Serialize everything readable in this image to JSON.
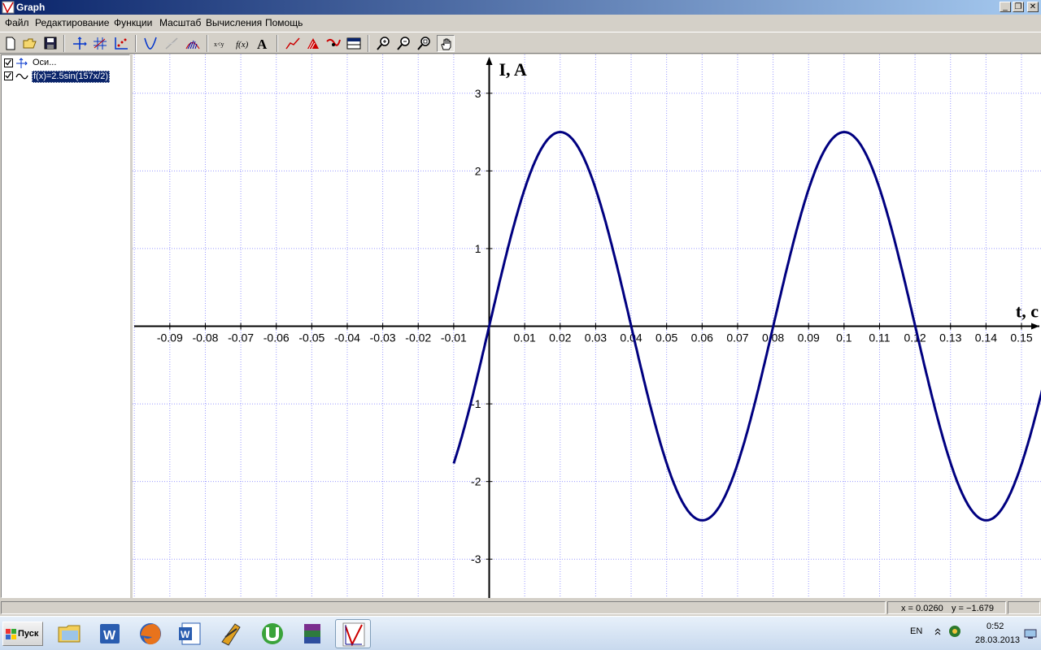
{
  "window": {
    "title": "Graph"
  },
  "menu": [
    "Файл",
    "Редактирование",
    "Функции",
    "Масштаб",
    "Вычисления",
    "Помощь"
  ],
  "toolbar": {
    "buttons": [
      "new-file",
      "open-folder",
      "save",
      "insert-axes",
      "insert-axes-grid",
      "insert-point-series",
      "insert-function",
      "insert-tangent",
      "insert-shading",
      "insert-relation",
      "insert-f-of-x",
      "insert-label",
      "insert-trendline",
      "insert-shading-area",
      "insert-series",
      "table",
      "zoom-in",
      "zoom-out",
      "zoom-square",
      "move-hand"
    ],
    "f_of_x_glyph": "f(x)",
    "relation_glyph": "x<y",
    "label_glyph": "A"
  },
  "tree": {
    "items": [
      {
        "label": "Оси...",
        "checked": true
      },
      {
        "label": "f(x)=2.5sin(157x/2)",
        "checked": true,
        "selected": true
      }
    ]
  },
  "chart_data": {
    "type": "line",
    "function": "f(x)=2.5sin(157x/2)",
    "xlabel": "t, c",
    "ylabel": "I, A",
    "xlim": [
      -0.1005,
      0.1555
    ],
    "ylim": [
      -3.5,
      3.5
    ],
    "x_ticks": [
      -0.09,
      -0.08,
      -0.07,
      -0.06,
      -0.05,
      -0.04,
      -0.03,
      -0.02,
      -0.01,
      0.01,
      0.02,
      0.03,
      0.04,
      0.05,
      0.06,
      0.07,
      0.08,
      0.09,
      0.1,
      0.11,
      0.12,
      0.13,
      0.14,
      0.15
    ],
    "x_tick_labels": [
      "-0.09",
      "-0.08",
      "-0.07",
      "-0.06",
      "-0.05",
      "-0.04",
      "-0.03",
      "-0.02",
      "-0.01",
      "0.01",
      "0.02",
      "0.03",
      "0.04",
      "0.05",
      "0.06",
      "0.07",
      "0.08",
      "0.09",
      "0.1",
      "0.11",
      "0.12",
      "0.13",
      "0.14",
      "0.15"
    ],
    "y_ticks": [
      -3,
      -2,
      -1,
      1,
      2,
      3
    ],
    "y_tick_labels": [
      "-3",
      "-2",
      "-1",
      "1",
      "2",
      "3"
    ],
    "series": [
      {
        "name": "f(x)=2.5sin(157x/2)",
        "color": "#000080",
        "domain": [
          -0.01,
          0.16
        ],
        "x": [
          -0.01,
          -0.005,
          0,
          0.005,
          0.01,
          0.015,
          0.02,
          0.025,
          0.03,
          0.035,
          0.04,
          0.045,
          0.05,
          0.055,
          0.06,
          0.065,
          0.07,
          0.075,
          0.08,
          0.085,
          0.09,
          0.095,
          0.1,
          0.105,
          0.11,
          0.115,
          0.12,
          0.125,
          0.13,
          0.135,
          0.14,
          0.145,
          0.15,
          0.155,
          0.16
        ],
        "y": [
          -1.77,
          -0.96,
          0,
          0.96,
          1.77,
          2.31,
          2.5,
          2.31,
          1.77,
          0.96,
          0,
          -0.96,
          -1.77,
          -2.31,
          -2.5,
          -2.31,
          -1.77,
          -0.96,
          0,
          0.96,
          1.77,
          2.31,
          2.5,
          2.31,
          1.77,
          0.96,
          0,
          -0.96,
          -1.77,
          -2.31,
          -2.5,
          -2.31,
          -1.77,
          -0.96,
          0
        ]
      }
    ],
    "grid": true,
    "grid_color": "#9999ff"
  },
  "status": {
    "x_text": "x = 0.0260",
    "y_text": "y = −1.679"
  },
  "taskbar": {
    "start_label": "Пуск",
    "apps": [
      "explorer",
      "word",
      "firefox",
      "word-doc",
      "winamp",
      "utorrent",
      "winrar",
      "graph"
    ],
    "active_app": "graph",
    "language": "EN",
    "time": "0:52",
    "date": "28.03.2013"
  },
  "colors": {
    "titlebar_start": "#0a246a",
    "titlebar_end": "#a6caf0",
    "curve": "#000080",
    "grid": "#9999ff"
  }
}
